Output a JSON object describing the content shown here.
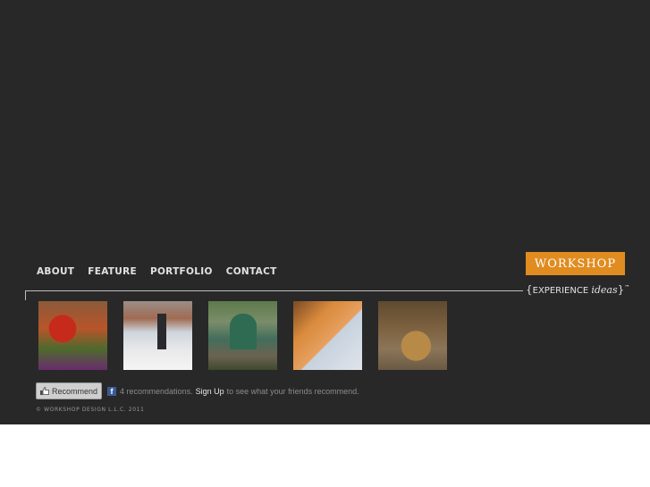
{
  "nav": {
    "items": [
      {
        "label": "ABOUT"
      },
      {
        "label": "FEATURE"
      },
      {
        "label": "PORTFOLIO"
      },
      {
        "label": "CONTACT"
      }
    ]
  },
  "brand": {
    "logo_text": "WORKSHOP",
    "tagline_open": "{",
    "tagline_main": "EXPERIENCE ",
    "tagline_italic": "ideas",
    "tagline_close": "}",
    "trademark": "™",
    "accent_color": "#e08c20"
  },
  "portfolio": {
    "thumbnails": [
      {
        "icon": "photo-fitness-exhibit"
      },
      {
        "icon": "photo-statue-plaza"
      },
      {
        "icon": "photo-park-sign"
      },
      {
        "icon": "photo-toy-display"
      },
      {
        "icon": "photo-interior-sculpture"
      }
    ]
  },
  "social": {
    "recommend_label": "Recommend",
    "fb_glyph": "f",
    "count_text": "4 recommendations.",
    "signup_label": "Sign Up",
    "suffix_text": "to see what your friends recommend."
  },
  "footer": {
    "copyright": "© WORKSHOP DESIGN L.L.C. 2011"
  }
}
